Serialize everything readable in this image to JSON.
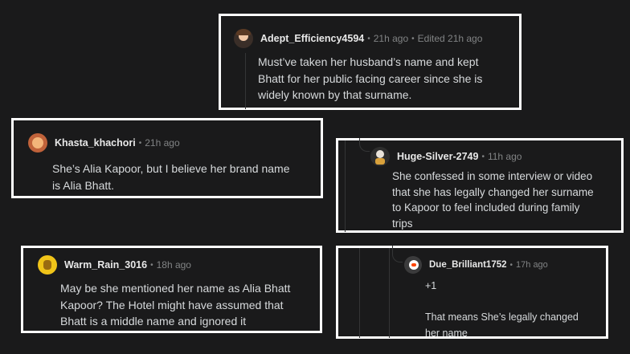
{
  "comments": [
    {
      "username": "Adept_Efficiency4594",
      "time": "21h ago",
      "edited": "Edited 21h ago",
      "avatar_icon": "avatar-icon",
      "lines": [
        "Must’ve taken her husband’s name and kept",
        "Bhatt for her public facing career since she is",
        "widely known by that surname."
      ]
    },
    {
      "username": "Khasta_khachori",
      "time": "21h ago",
      "avatar_icon": "avatar-icon",
      "lines": [
        "She’s Alia Kapoor, but I believe her brand name",
        "is Alia Bhatt."
      ]
    },
    {
      "username": "Huge-Silver-2749",
      "time": "11h ago",
      "avatar_icon": "avatar-icon",
      "lines": [
        "She confessed in some interview or video",
        "that she has legally changed her surname",
        "to Kapoor to feel included during family",
        "trips"
      ]
    },
    {
      "username": "Warm_Rain_3016",
      "time": "18h ago",
      "avatar_icon": "avatar-icon",
      "lines": [
        "May be she mentioned her name as Alia Bhatt",
        "Kapoor? The Hotel might have assumed that",
        "Bhatt is a middle name and ignored it"
      ]
    },
    {
      "username": "Due_Brilliant1752",
      "time": "17h ago",
      "avatar_icon": "avatar-icon",
      "lines": [
        "+1",
        "",
        "That means She’s legally changed",
        "her name"
      ]
    }
  ],
  "colors": {
    "background": "#1a1a1b",
    "border": "#ffffff",
    "text": "#d7dadc",
    "meta": "#818384",
    "thread": "#343536"
  }
}
